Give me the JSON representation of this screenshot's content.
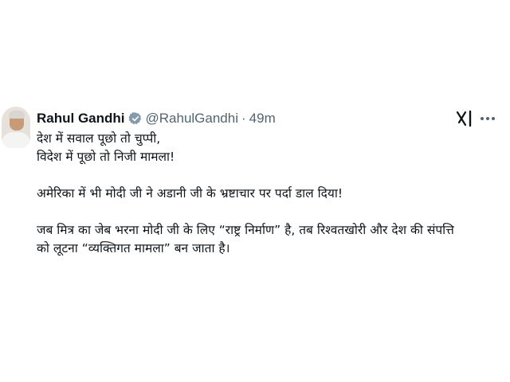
{
  "tweet": {
    "author": {
      "name": "Rahul Gandhi",
      "handle": "@RahulGandhi",
      "separator": "·",
      "time": "49m",
      "verified_color": "#829aab"
    },
    "lines": {
      "l1": "देश में सवाल पूछो तो चुप्पी,",
      "l2": "विदेश में पूछो तो निजी मामला!",
      "l3": "अमेरिका में भी मोदी जी ने अडानी जी के भ्रष्टाचार पर पर्दा डाल दिया!",
      "l4": "जब मित्र का जेब भरना मोदी जी के लिए “राष्ट्र निर्माण” है, तब रिश्वतखोरी और देश की संपत्ति",
      "l5": "को लूटना “व्यक्तिगत मामला” बन जाता है।"
    },
    "icons": {
      "verified": "verified-badge-icon",
      "grok": "grok-icon",
      "more": "more-options-icon"
    }
  }
}
